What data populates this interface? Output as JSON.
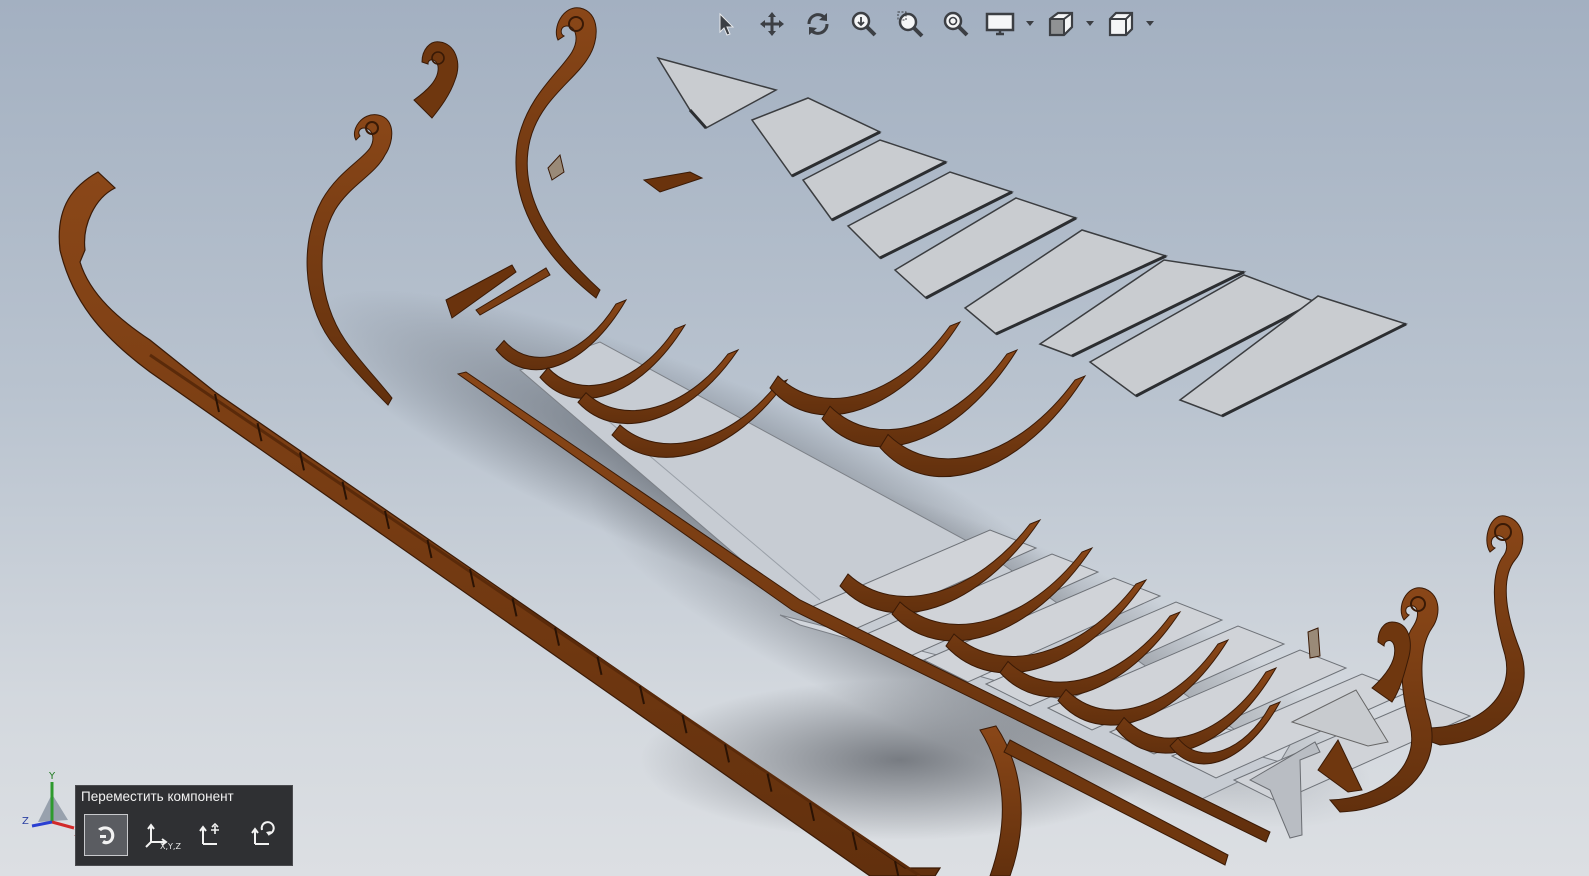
{
  "viewport": {
    "description_colors": {
      "background_top": "#a3b0c1",
      "background_bottom": "#dcdfe3",
      "wood": "#7a3e14",
      "wood_dark": "#4c2208",
      "panel": "#c9ccd0",
      "panel_edge": "#3b3d40"
    }
  },
  "view_toolbar": {
    "buttons": [
      {
        "name": "select",
        "icon": "cursor-arrow-icon"
      },
      {
        "name": "pan",
        "icon": "pan-arrows-icon"
      },
      {
        "name": "rotate",
        "icon": "rotate-icon"
      },
      {
        "name": "zoom-to-fit",
        "icon": "zoom-fit-icon"
      },
      {
        "name": "zoom-to-area",
        "icon": "zoom-area-icon"
      },
      {
        "name": "zoom-in-out",
        "icon": "zoom-icon"
      },
      {
        "name": "display-style",
        "icon": "monitor-icon",
        "dropdown": true
      },
      {
        "name": "section-view",
        "icon": "section-view-icon",
        "dropdown": true
      },
      {
        "name": "view-orientation",
        "icon": "cube-icon",
        "dropdown": true
      }
    ]
  },
  "triad": {
    "axes": [
      "Y",
      "Z",
      "X"
    ]
  },
  "move_component": {
    "title": "Переместить компонент",
    "buttons": [
      {
        "name": "free-drag",
        "icon": "free-drag-hand-icon",
        "label": "",
        "active": true
      },
      {
        "name": "move-xyz",
        "icon": "move-xyz-icon",
        "label": "X,Y,Z",
        "active": false
      },
      {
        "name": "move-along-entity",
        "icon": "move-along-entity-icon",
        "label": "",
        "active": false
      },
      {
        "name": "rotate-component",
        "icon": "rotate-component-icon",
        "label": "",
        "active": false
      }
    ]
  }
}
